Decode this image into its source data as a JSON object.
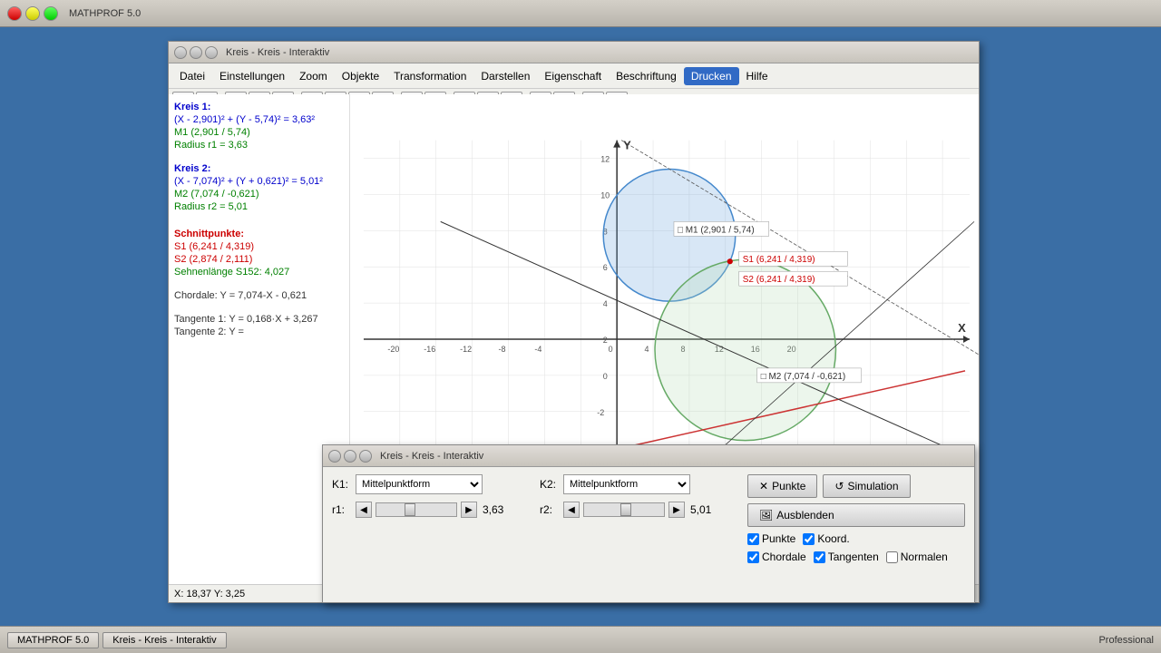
{
  "app": {
    "title": "MATHPROF 5.0",
    "main_window_title": "Kreis - Kreis - Interaktiv"
  },
  "titlebar": {
    "title": "MATHPROF 5.0"
  },
  "menu": {
    "items": [
      "Datei",
      "Einstellungen",
      "Zoom",
      "Objekte",
      "Transformation",
      "Darstellen",
      "Eigenschaft",
      "Beschriftung",
      "Drucken",
      "Hilfe"
    ]
  },
  "info_panel": {
    "kreis1_title": "Kreis 1:",
    "kreis1_eq": "(X - 2,901)² + (Y - 5,74)² = 3,63²",
    "kreis1_m": "M1 (2,901 / 5,74)",
    "kreis1_r": "Radius r1 = 3,63",
    "kreis2_title": "Kreis 2:",
    "kreis2_eq": "(X - 7,074)² + (Y + 0,621)² = 5,01²",
    "kreis2_m": "M2 (7,074 / -0,621)",
    "kreis2_r": "Radius r2 = 5,01",
    "schnittpunkte": "Schnittpunkte:",
    "s1": "S1 (6,241 / 4,319)",
    "s2": "S2 (2,874 / 2,111)",
    "sehnlaenge": "Sehnenlänge S152: 4,027",
    "chordale": "Chordale: Y = 7,074-X - 0,621",
    "tangente1": "Tangente 1: Y = 0,168·X + 3,267",
    "tangente2": "Tangente 2: Y ="
  },
  "graph": {
    "x_label": "X",
    "y_label": "Y",
    "m1_label": "M1 (2,901 / 5,74)",
    "m2_label": "M2 (7,074 / -0,621)",
    "s1_label": "S1 (6,241 / 4,319)",
    "s2_label": "S2 (6,241 / 4,319)"
  },
  "controls": {
    "window_title": "Kreis - Kreis - Interaktiv",
    "k1_label": "K1:",
    "k2_label": "K2:",
    "k1_select": "Mittelpunktform",
    "k2_select": "Mittelpunktform",
    "r1_label": "r1:",
    "r2_label": "r2:",
    "r1_value": "3,63",
    "r2_value": "5,01",
    "punkte_btn": "Punkte",
    "simulation_btn": "Simulation",
    "ausblenden_btn": "Ausblenden",
    "checkboxes": {
      "punkte": "Punkte",
      "koord": "Koord.",
      "chordale": "Chordale",
      "tangenten": "Tangenten",
      "normalen": "Normalen"
    }
  },
  "statusbar": {
    "coords": "X: 18,37  Y: 3,25"
  },
  "taskbar": {
    "app_name": "MATHPROF 5.0",
    "window_name": "Kreis - Kreis - Interaktiv",
    "edition": "Professional"
  }
}
